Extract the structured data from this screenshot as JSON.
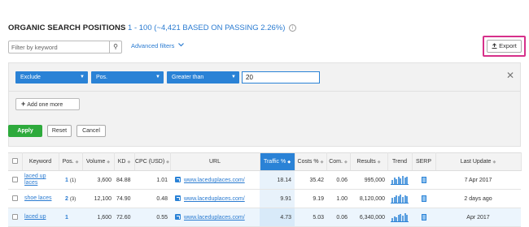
{
  "header": {
    "title": "ORGANIC SEARCH POSITIONS",
    "range": "1 - 100 (~4,421 BASED ON PASSING 2.26%)",
    "info_glyph": "i"
  },
  "toolbar": {
    "filter_placeholder": "Filter by keyword",
    "search_glyph": "⚲",
    "advanced_filters": "Advanced filters",
    "export_label": "Export"
  },
  "filters": {
    "mode": "Exclude",
    "field": "Pos.",
    "operator": "Greater than",
    "value": "20",
    "add_one_more": "Add one more",
    "apply": "Apply",
    "reset": "Reset",
    "cancel": "Cancel"
  },
  "table": {
    "columns": [
      "Keyword",
      "Pos.",
      "Volume",
      "KD",
      "CPC (USD)",
      "URL",
      "Traffic %",
      "Costs %",
      "Com.",
      "Results",
      "Trend",
      "SERP",
      "Last Update"
    ],
    "active_sort_column": "Traffic %",
    "rows": [
      {
        "keyword": "laced up laces",
        "pos": "1",
        "pos_prev": "(1)",
        "volume": "3,600",
        "kd": "84.88",
        "cpc": "1.01",
        "url": "www.laceduplaces.com/",
        "traffic": "18.14",
        "costs": "35.42",
        "com": "0.06",
        "results": "995,000",
        "trend": [
          5,
          8,
          6,
          9,
          7,
          10,
          8,
          9
        ],
        "last_update": "7 Apr 2017"
      },
      {
        "keyword": "shoe laces",
        "pos": "2",
        "pos_prev": "(3)",
        "volume": "12,100",
        "kd": "74.90",
        "cpc": "0.48",
        "url": "www.laceduplaces.com/",
        "traffic": "9.91",
        "costs": "9.19",
        "com": "1.00",
        "results": "8,120,000",
        "trend": [
          6,
          7,
          9,
          8,
          10,
          7,
          9,
          8
        ],
        "last_update": "2 days ago"
      },
      {
        "keyword": "laced up",
        "pos": "1",
        "pos_prev": "",
        "volume": "1,600",
        "kd": "72.60",
        "cpc": "0.55",
        "url": "www.laceduplaces.com/",
        "traffic": "4.73",
        "costs": "5.03",
        "com": "0.06",
        "results": "6,340,000",
        "trend": [
          4,
          6,
          5,
          8,
          9,
          7,
          10,
          8
        ],
        "last_update": "Apr 2017"
      }
    ]
  },
  "colors": {
    "accent": "#2a82d6",
    "apply_green": "#2eaa3c",
    "export_highlight": "#d6308a"
  }
}
